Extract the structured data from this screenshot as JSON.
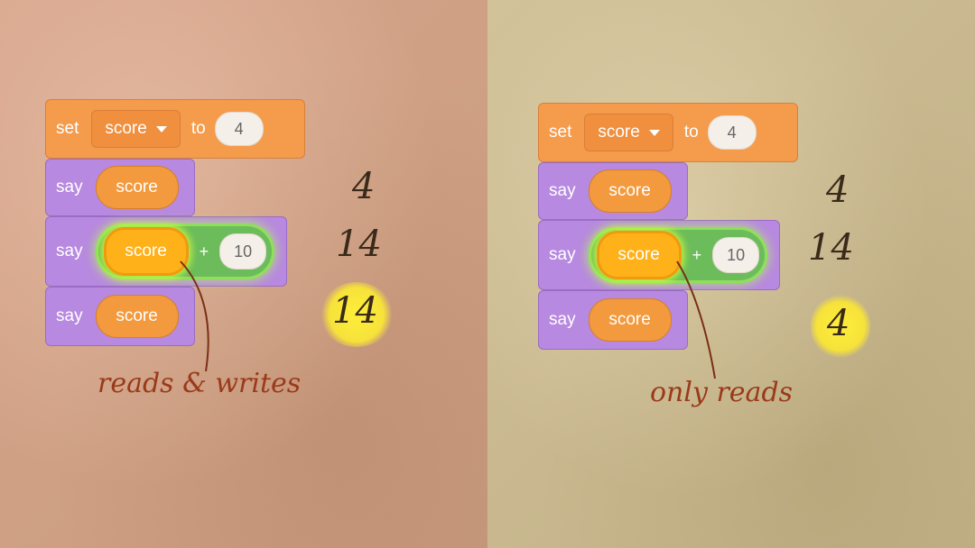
{
  "left": {
    "set_block": {
      "keyword": "set",
      "variable": "score",
      "to": "to",
      "value": "4"
    },
    "say1": {
      "keyword": "say",
      "reporter": "score"
    },
    "say2": {
      "keyword": "say",
      "reporter": "score",
      "operator": "+",
      "operand": "10"
    },
    "say3": {
      "keyword": "say",
      "reporter": "score"
    },
    "outputs": [
      "4",
      "14",
      "14"
    ],
    "note": "reads & writes"
  },
  "right": {
    "set_block": {
      "keyword": "set",
      "variable": "score",
      "to": "to",
      "value": "4"
    },
    "say1": {
      "keyword": "say",
      "reporter": "score"
    },
    "say2": {
      "keyword": "say",
      "reporter": "score",
      "operator": "+",
      "operand": "10"
    },
    "say3": {
      "keyword": "say",
      "reporter": "score"
    },
    "outputs": [
      "4",
      "14",
      "4"
    ],
    "note": "only reads"
  },
  "colors": {
    "set_block": "#f59b4c",
    "say_block": "#b889e0",
    "reporter": "#f29a3d",
    "operator": "#6cbc5c",
    "highlight": "#ffee3a",
    "note": "#9a3a1a"
  }
}
